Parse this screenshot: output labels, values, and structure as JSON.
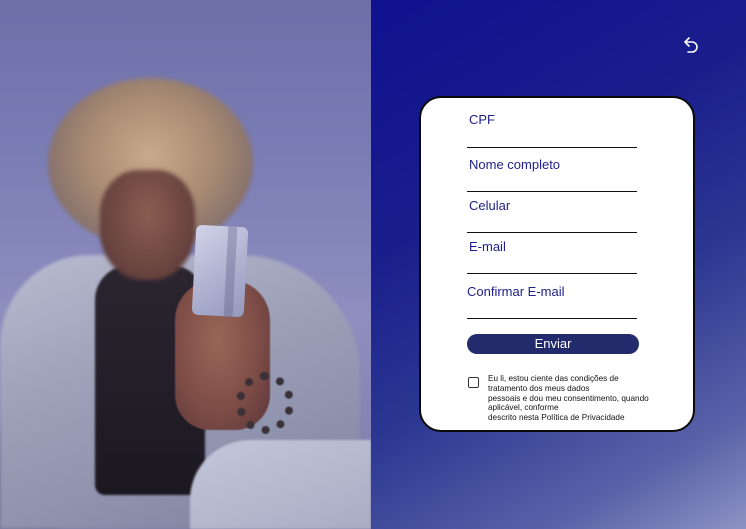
{
  "form": {
    "fields": [
      {
        "label": "CPF",
        "value": ""
      },
      {
        "label": "Nome completo",
        "value": ""
      },
      {
        "label": "Celular",
        "value": ""
      },
      {
        "label": "E-mail",
        "value": ""
      },
      {
        "label": "Confirmar E-mail",
        "value": ""
      }
    ],
    "submit_label": "Enviar",
    "consent": {
      "checked": false,
      "lines": [
        "Eu li, estou ciente das condições de",
        "tratamento dos meus dados",
        "pessoais e dou meu consentimento, quando",
        "aplicável, conforme",
        "descrito nesta Política de Privacidade"
      ]
    }
  },
  "header": {
    "back_icon": "back-arrow-icon"
  },
  "colors": {
    "label_text": "#1c1f8a",
    "button_bg": "#232b6c",
    "panel_gradient_start": "#0f1190",
    "panel_gradient_end": "#8d93c3"
  }
}
